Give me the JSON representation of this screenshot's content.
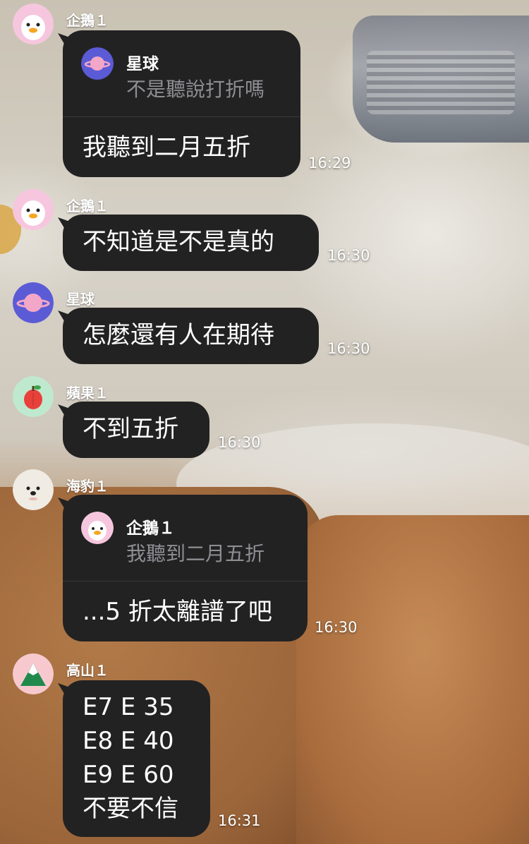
{
  "messages": [
    {
      "sender": "企鵝１",
      "avatar_icon": "penguin-icon",
      "reply_to": {
        "sender": "星球",
        "avatar_icon": "planet-icon",
        "text": "不是聽說打折嗎"
      },
      "text": "我聽到二月五折",
      "time": "16:29"
    },
    {
      "sender": "企鵝１",
      "avatar_icon": "penguin-icon",
      "text": "不知道是不是真的",
      "time": "16:30"
    },
    {
      "sender": "星球",
      "avatar_icon": "planet-icon",
      "text": "怎麼還有人在期待",
      "time": "16:30"
    },
    {
      "sender": "蘋果１",
      "avatar_icon": "apple-icon",
      "text": "不到五折",
      "time": "16:30"
    },
    {
      "sender": "海豹１",
      "avatar_icon": "seal-icon",
      "reply_to": {
        "sender": "企鵝１",
        "avatar_icon": "penguin-icon",
        "text": "我聽到二月五折"
      },
      "text": "...5 折太離譜了吧",
      "time": "16:30"
    },
    {
      "sender": "高山１",
      "avatar_icon": "mountain-icon",
      "lines": [
        "E7 E 35",
        "E8 E 40",
        "E9 E 60",
        "不要不信"
      ],
      "time": "16:31"
    }
  ],
  "colors": {
    "bubble": "#222223",
    "quote_text": "#8e8e93",
    "penguin_avatar_bg": "#f6c6de",
    "planet_avatar_bg": "#5b5bd6",
    "apple_avatar_bg": "#bfe9cf",
    "seal_avatar_bg": "#f0ebe3",
    "mountain_avatar_bg": "#f7c9cf"
  }
}
